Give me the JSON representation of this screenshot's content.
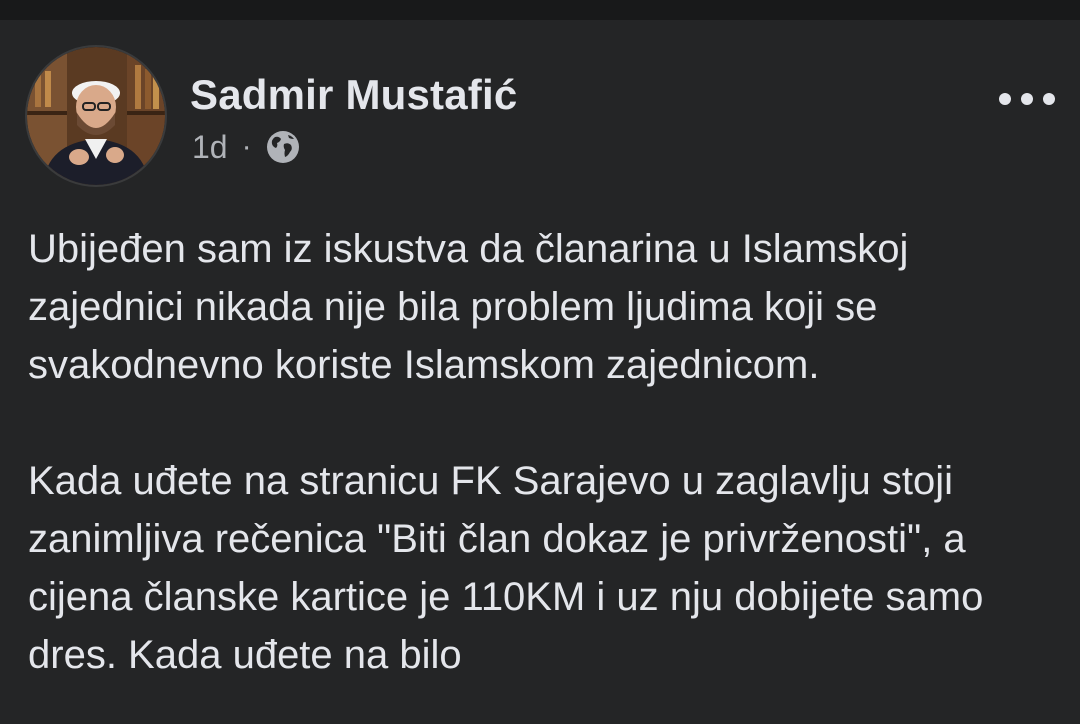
{
  "post": {
    "author": "Sadmir Mustafić",
    "time": "1d",
    "separator": "·",
    "visibility_icon": "globe-icon",
    "avatar_icon": "avatar",
    "more_icon": "more-options-icon",
    "paragraphs": [
      "Ubijeđen sam iz iskustva da članarina u Islamskoj zajednici nikada nije bila problem ljudima koji se svakodnevno koriste Islamskom zajednicom.",
      "Kada uđete na stranicu FK Sarajevo u zaglavlju stoji zanimljiva rečenica \"Biti član dokaz je privrženosti\", a cijena članske kartice je 110KM i uz nju dobijete samo dres. Kada uđete na bilo"
    ]
  },
  "colors": {
    "background": "#242526",
    "text": "#e4e6eb",
    "secondary_text": "#b0b3b8"
  }
}
